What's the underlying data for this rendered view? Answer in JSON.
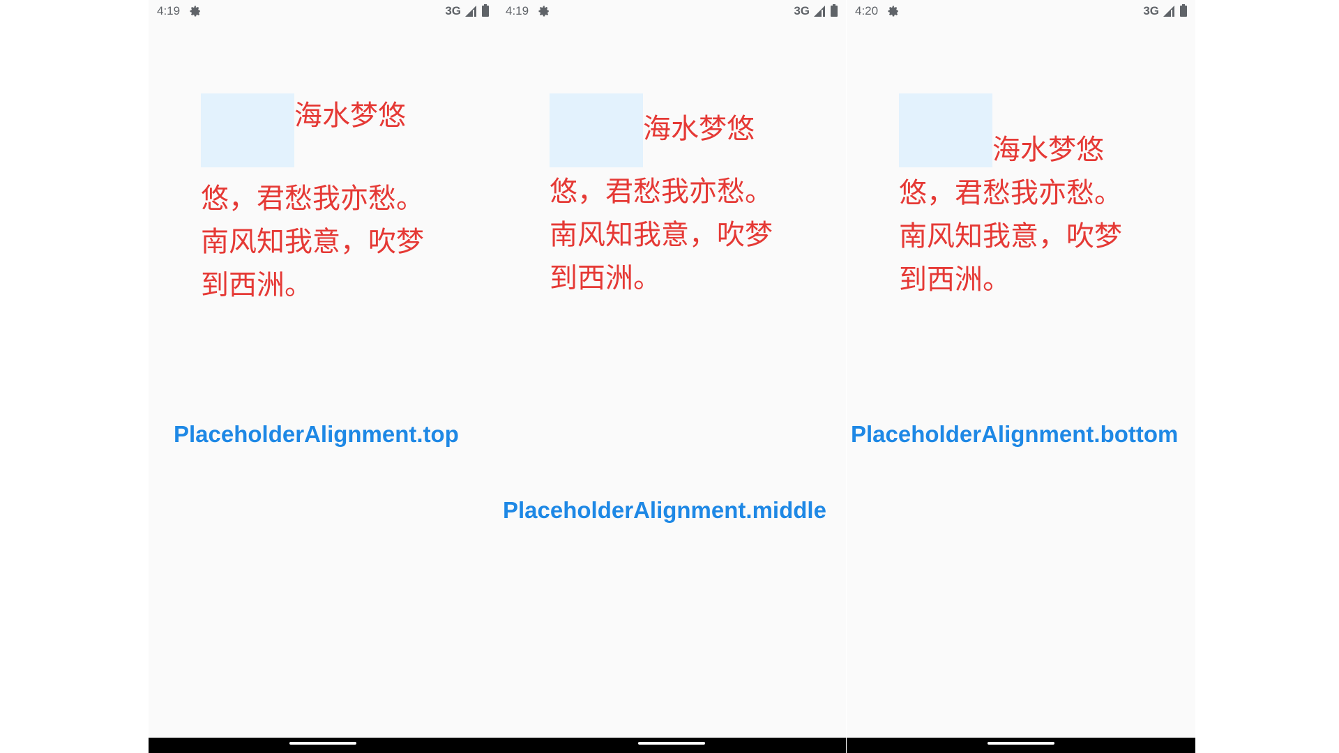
{
  "colors": {
    "screen_background": "#fafafa",
    "placeholder": "#e3f2fd",
    "poem_text": "#e53935",
    "caption_text": "#1e88e5",
    "status_text": "#5f6368"
  },
  "screens": [
    {
      "status": {
        "time": "4:19",
        "network": "3G",
        "icons": [
          "gear-icon",
          "signal-icon",
          "battery-icon"
        ]
      },
      "poem": [
        "海水梦悠",
        "悠，君愁我亦愁。",
        "南风知我意，吹梦",
        "到西洲。"
      ],
      "placeholder_alignment": "top"
    },
    {
      "status": {
        "time": "4:19",
        "network": "3G",
        "icons": [
          "gear-icon",
          "signal-icon",
          "battery-icon"
        ]
      },
      "poem": [
        "海水梦悠",
        "悠，君愁我亦愁。",
        "南风知我意，吹梦",
        "到西洲。"
      ],
      "placeholder_alignment": "middle"
    },
    {
      "status": {
        "time": "4:20",
        "network": "3G",
        "icons": [
          "gear-icon",
          "signal-icon",
          "battery-icon"
        ]
      },
      "poem": [
        "海水梦悠",
        "悠，君愁我亦愁。",
        "南风知我意，吹梦",
        "到西洲。"
      ],
      "placeholder_alignment": "bottom"
    }
  ],
  "captions": {
    "top": "PlaceholderAlignment.top",
    "middle": "PlaceholderAlignment.middle",
    "bottom": "PlaceholderAlignment.bottom"
  }
}
